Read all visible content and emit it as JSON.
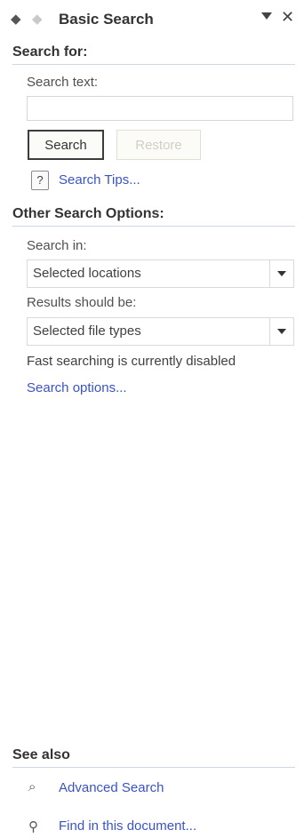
{
  "titlebar": {
    "title": "Basic Search",
    "back_icon": "back-arrow-icon",
    "forward_icon": "forward-arrow-icon",
    "close_glyph": "✕"
  },
  "search_for": {
    "header": "Search for:",
    "search_text_label": "Search text:",
    "search_text_value": "",
    "search_button": "Search",
    "restore_button": "Restore",
    "tips_link": "Search Tips..."
  },
  "other_options": {
    "header": "Other Search Options:",
    "search_in_label": "Search in:",
    "search_in_value": "Selected locations",
    "results_label": "Results should be:",
    "results_value": "Selected file types",
    "status_text": "Fast searching is currently disabled",
    "options_link": "Search options..."
  },
  "see_also": {
    "header": "See also",
    "advanced_search": "Advanced Search",
    "find_in_document": "Find in this document..."
  }
}
